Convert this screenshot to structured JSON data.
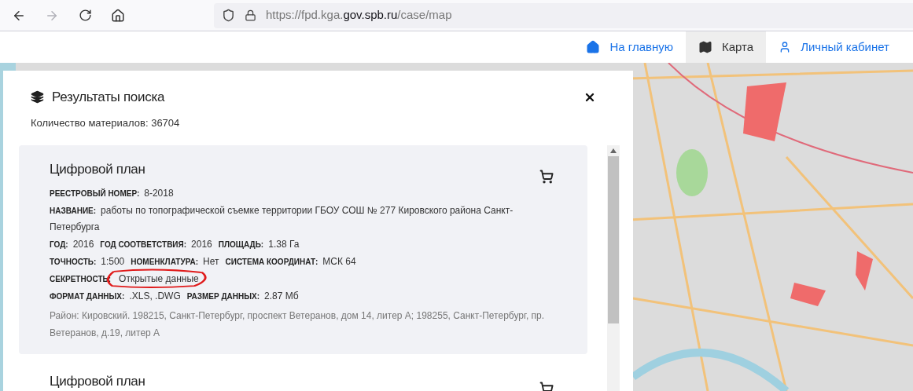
{
  "browser": {
    "forward_disabled": true,
    "url": {
      "prefix": "https://fpd.kga.",
      "domain": "gov.spb.ru",
      "path": "/case/map"
    }
  },
  "nav": [
    {
      "label": "На главную",
      "kind": "home",
      "selected": false
    },
    {
      "label": "Карта",
      "kind": "map",
      "selected": true
    },
    {
      "label": "Личный кабинет",
      "kind": "user",
      "selected": false
    }
  ],
  "results": {
    "title": "Результаты поиска",
    "count": "Количество материалов: 36704",
    "cards": [
      {
        "title": "Цифровой план",
        "rows": [
          [
            {
              "label": "РЕЕСТРОВЫЙ НОМЕР:",
              "value": "8-2018"
            }
          ],
          [
            {
              "label": "НАЗВАНИЕ:",
              "value": "работы по топографической съемке территории ГБОУ СОШ № 277 Кировского района Санкт-Петербурга"
            }
          ],
          [
            {
              "label": "ГОД:",
              "value": "2016"
            },
            {
              "label": "ГОД СООТВЕТСТВИЯ:",
              "value": "2016"
            },
            {
              "label": "ПЛОЩАДЬ:",
              "value": "1.38 Га"
            }
          ],
          [
            {
              "label": "ТОЧНОСТЬ:",
              "value": "1:500"
            },
            {
              "label": "НОМЕНКЛАТУРА:",
              "value": "Нет"
            },
            {
              "label": "СИСТЕМА КООРДИНАТ:",
              "value": "МСК 64"
            }
          ],
          [
            {
              "label": "СЕКРЕТНОСТЬ:",
              "value": "Открытые данные",
              "circled": true
            }
          ],
          [
            {
              "label": "ФОРМАТ ДАННЫХ:",
              "value": ".XLS, .DWG"
            },
            {
              "label": "РАЗМЕР ДАННЫХ:",
              "value": "2.87 Мб"
            }
          ]
        ],
        "address": "Район: Кировский. 198215, Санкт-Петербург, проспект Ветеранов, дом 14, литер А; 198255, Санкт-Петербург, пр. Ветеранов, д.19, литер А"
      },
      {
        "title": "Цифровой план"
      }
    ]
  }
}
